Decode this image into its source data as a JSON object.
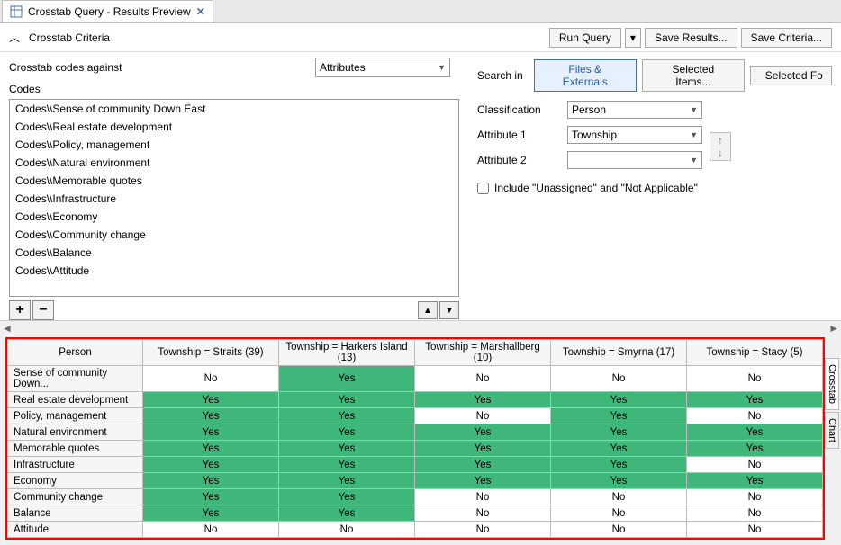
{
  "tab": {
    "title": "Crosstab Query - Results Preview"
  },
  "criteria": {
    "header": "Crosstab Criteria",
    "run": "Run Query",
    "save_results": "Save Results...",
    "save_criteria": "Save Criteria..."
  },
  "left": {
    "against_label": "Crosstab codes against",
    "against_value": "Attributes",
    "codes_label": "Codes",
    "codes": [
      "Codes\\\\Sense of community Down East",
      "Codes\\\\Real estate development",
      "Codes\\\\Policy, management",
      "Codes\\\\Natural environment",
      "Codes\\\\Memorable quotes",
      "Codes\\\\Infrastructure",
      "Codes\\\\Economy",
      "Codes\\\\Community change",
      "Codes\\\\Balance",
      "Codes\\\\Attitude"
    ]
  },
  "right": {
    "search_label": "Search in",
    "files_ext": "Files & Externals",
    "selected_items": "Selected Items...",
    "selected_folders": "Selected Fo",
    "classification_label": "Classification",
    "classification_value": "Person",
    "attr1_label": "Attribute 1",
    "attr1_value": "Township",
    "attr2_label": "Attribute 2",
    "attr2_value": "",
    "include_label": "Include \"Unassigned\" and \"Not Applicable\""
  },
  "yes": "Yes",
  "no": "No",
  "results": {
    "row_header": "Person",
    "columns": [
      "Township = Straits (39)",
      "Township = Harkers Island (13)",
      "Township = Marshallberg (10)",
      "Township = Smyrna (17)",
      "Township = Stacy (5)"
    ],
    "rows": [
      {
        "label": "Sense of community Down...",
        "vals": [
          "No",
          "Yes",
          "No",
          "No",
          "No"
        ]
      },
      {
        "label": "Real estate development",
        "vals": [
          "Yes",
          "Yes",
          "Yes",
          "Yes",
          "Yes"
        ]
      },
      {
        "label": "Policy, management",
        "vals": [
          "Yes",
          "Yes",
          "No",
          "Yes",
          "No"
        ]
      },
      {
        "label": "Natural environment",
        "vals": [
          "Yes",
          "Yes",
          "Yes",
          "Yes",
          "Yes"
        ]
      },
      {
        "label": "Memorable quotes",
        "vals": [
          "Yes",
          "Yes",
          "Yes",
          "Yes",
          "Yes"
        ]
      },
      {
        "label": "Infrastructure",
        "vals": [
          "Yes",
          "Yes",
          "Yes",
          "Yes",
          "No"
        ]
      },
      {
        "label": "Economy",
        "vals": [
          "Yes",
          "Yes",
          "Yes",
          "Yes",
          "Yes"
        ]
      },
      {
        "label": "Community change",
        "vals": [
          "Yes",
          "Yes",
          "No",
          "No",
          "No"
        ]
      },
      {
        "label": "Balance",
        "vals": [
          "Yes",
          "Yes",
          "No",
          "No",
          "No"
        ]
      },
      {
        "label": "Attitude",
        "vals": [
          "No",
          "No",
          "No",
          "No",
          "No"
        ]
      }
    ]
  },
  "side": {
    "crosstab": "Crosstab",
    "chart": "Chart"
  }
}
